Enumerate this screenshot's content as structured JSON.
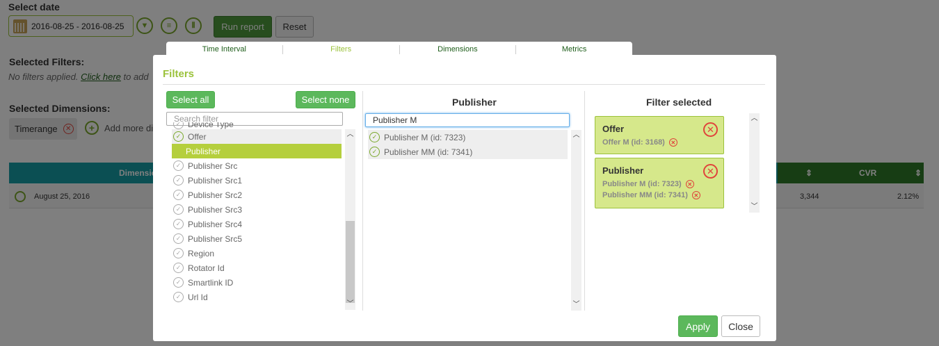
{
  "page": {
    "select_date_label": "Select date",
    "date_range": "2016-08-25 - 2016-08-25",
    "run_report": "Run report",
    "reset": "Reset",
    "selected_filters_label": "Selected Filters:",
    "no_filters_text": "No filters applied.",
    "click_here": "Click here",
    "to_add": "to add",
    "selected_dimensions_label": "Selected Dimensions:",
    "dimension_chip": "Timerange",
    "add_more": "Add more di",
    "table": {
      "dimension_header": "Dimensio",
      "cvr_header": "CVR",
      "row_date": "August 25, 2016",
      "row_value": "3,344",
      "row_cvr": "2.12%"
    }
  },
  "modal": {
    "tabs": [
      "Time Interval",
      "Filters",
      "Dimensions",
      "Metrics"
    ],
    "active_tab": "Filters",
    "title": "Filters",
    "left": {
      "select_all": "Select all",
      "select_none": "Select none",
      "search_placeholder": "Search filter",
      "items": [
        {
          "label": "Device Type",
          "state": "cut"
        },
        {
          "label": "Offer",
          "state": "on"
        },
        {
          "label": "Publisher",
          "state": "selected"
        },
        {
          "label": "Publisher Src",
          "state": "off"
        },
        {
          "label": "Publisher Src1",
          "state": "off"
        },
        {
          "label": "Publisher Src2",
          "state": "off"
        },
        {
          "label": "Publisher Src3",
          "state": "off"
        },
        {
          "label": "Publisher Src4",
          "state": "off"
        },
        {
          "label": "Publisher Src5",
          "state": "off"
        },
        {
          "label": "Region",
          "state": "off"
        },
        {
          "label": "Rotator Id",
          "state": "off"
        },
        {
          "label": "Smartlink ID",
          "state": "off"
        },
        {
          "label": "Url Id",
          "state": "off"
        }
      ]
    },
    "middle": {
      "title": "Publisher",
      "search_value": "Publisher M",
      "items": [
        {
          "label": "Publisher M (id: 7323)",
          "state": "on"
        },
        {
          "label": "Publisher MM (id: 7341)",
          "state": "on"
        }
      ]
    },
    "right": {
      "title": "Filter selected",
      "cards": [
        {
          "title": "Offer",
          "values": [
            "Offer M (id: 3168)"
          ]
        },
        {
          "title": "Publisher",
          "values": [
            "Publisher M (id: 7323)",
            "Publisher MM (id: 7341)"
          ]
        }
      ]
    },
    "apply": "Apply",
    "close": "Close"
  },
  "icons": {
    "check": "✓",
    "close": "✕",
    "up": "︿",
    "down": "﹀"
  },
  "colors": {
    "accent_green": "#9bc23b",
    "button_green": "#5cb85c",
    "selected_item": "#b5cf3d",
    "filter_card": "#d6e88b",
    "remove_red": "#e0433b"
  }
}
